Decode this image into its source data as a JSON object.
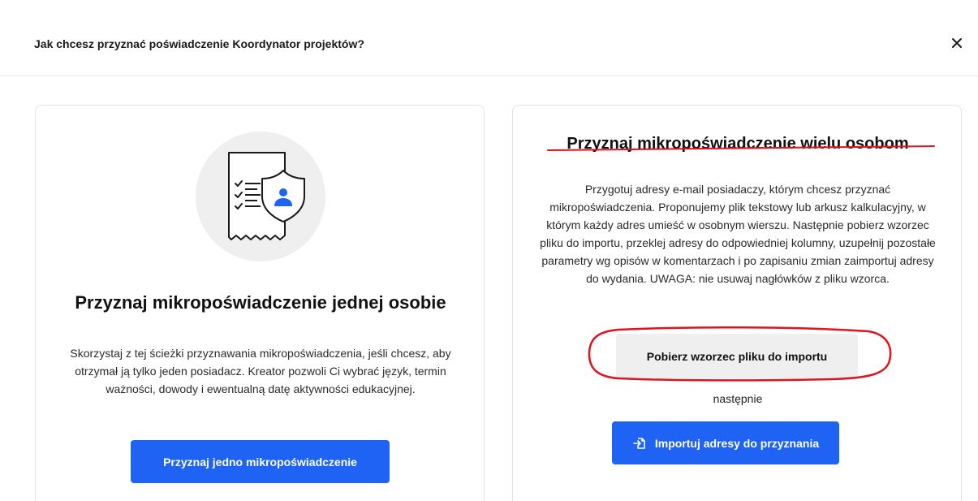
{
  "dialog": {
    "title": "Jak chcesz przyznać poświadczenie Koordynator projektów?",
    "close_icon": "close-icon"
  },
  "single": {
    "illustration_icon": "document-shield-user-icon",
    "title": "Przyznaj mikropoświadczenie jednej osobie",
    "description": "Skorzystaj z tej ścieżki przyznawania mikropoświadczenia, jeśli chcesz, aby otrzymał ją tylko jeden posiadacz. Kreator pozwoli Ci wybrać język, termin ważności, dowody i ewentualną datę aktywności edukacyjnej.",
    "button_label": "Przyznaj jedno mikropoświadczenie"
  },
  "multiple": {
    "title": "Przyznaj mikropoświadczenie wielu osobom",
    "description": "Przygotuj adresy e-mail posiadaczy, którym chcesz przyznać mikropoświadczenia. Proponujemy plik tekstowy lub arkusz kalkulacyjny, w którym każdy adres umieść w osobnym wierszu. Następnie pobierz wzorzec pliku do importu, przeklej adresy do odpowiedniej kolumny, uzupełnij pozostałe parametry wg opisów w komentarzach i po zapisaniu zmian zaimportuj adresy do wydania. UWAGA: nie usuwaj nagłówków z pliku wzorca.",
    "download_button_label": "Pobierz wzorzec pliku do importu",
    "then_text": "następnie",
    "import_button_label": "Importuj adresy do przyznania",
    "import_icon": "file-import-icon"
  },
  "colors": {
    "primary": "#1f63f5",
    "annotation_red": "#e0121b",
    "illustration_blue": "#1f63f5"
  }
}
